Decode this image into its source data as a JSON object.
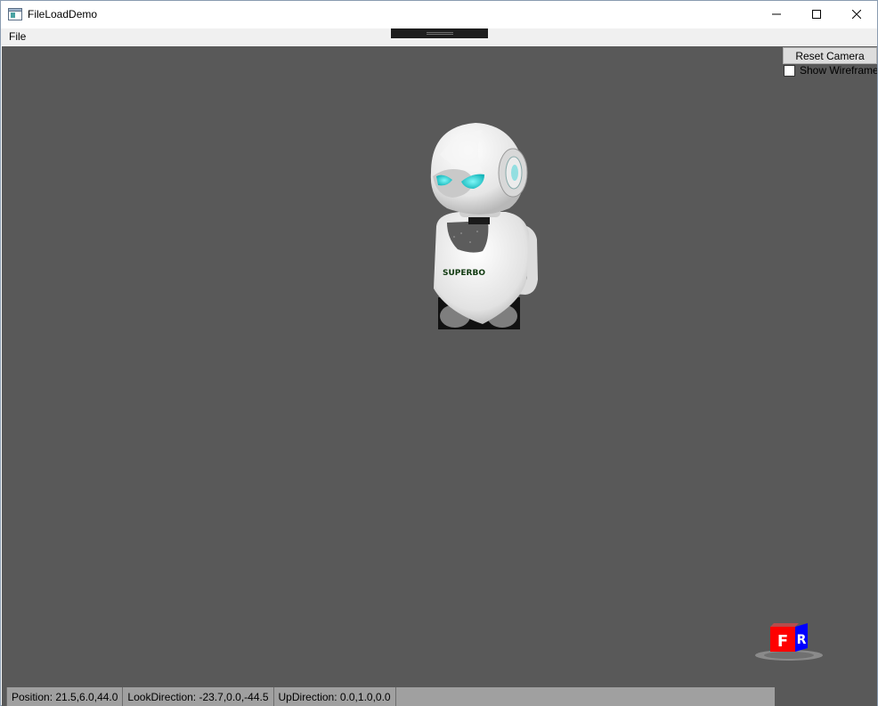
{
  "window": {
    "title": "FileLoadDemo",
    "controls": {
      "minimize_icon": "minimize-icon",
      "maximize_icon": "maximize-icon",
      "close_icon": "close-icon"
    }
  },
  "menu": {
    "items": [
      {
        "label": "File"
      }
    ]
  },
  "overlay": {
    "reset_camera_label": "Reset Camera",
    "show_wireframe_label": "Show Wireframe",
    "show_wireframe_checked": false
  },
  "scene": {
    "background_color": "#595959",
    "model": "robot",
    "chest_text": "SUPERBO",
    "view_cube": {
      "front_label": "F",
      "right_label": "R",
      "front_color": "#ff0000",
      "right_color": "#0000ff"
    }
  },
  "status": {
    "position": "Position: 21.5,6.0,44.0",
    "look_direction": "LookDirection: -23.7,0.0,-44.5",
    "up_direction": "UpDirection: 0.0,1.0,0.0"
  }
}
